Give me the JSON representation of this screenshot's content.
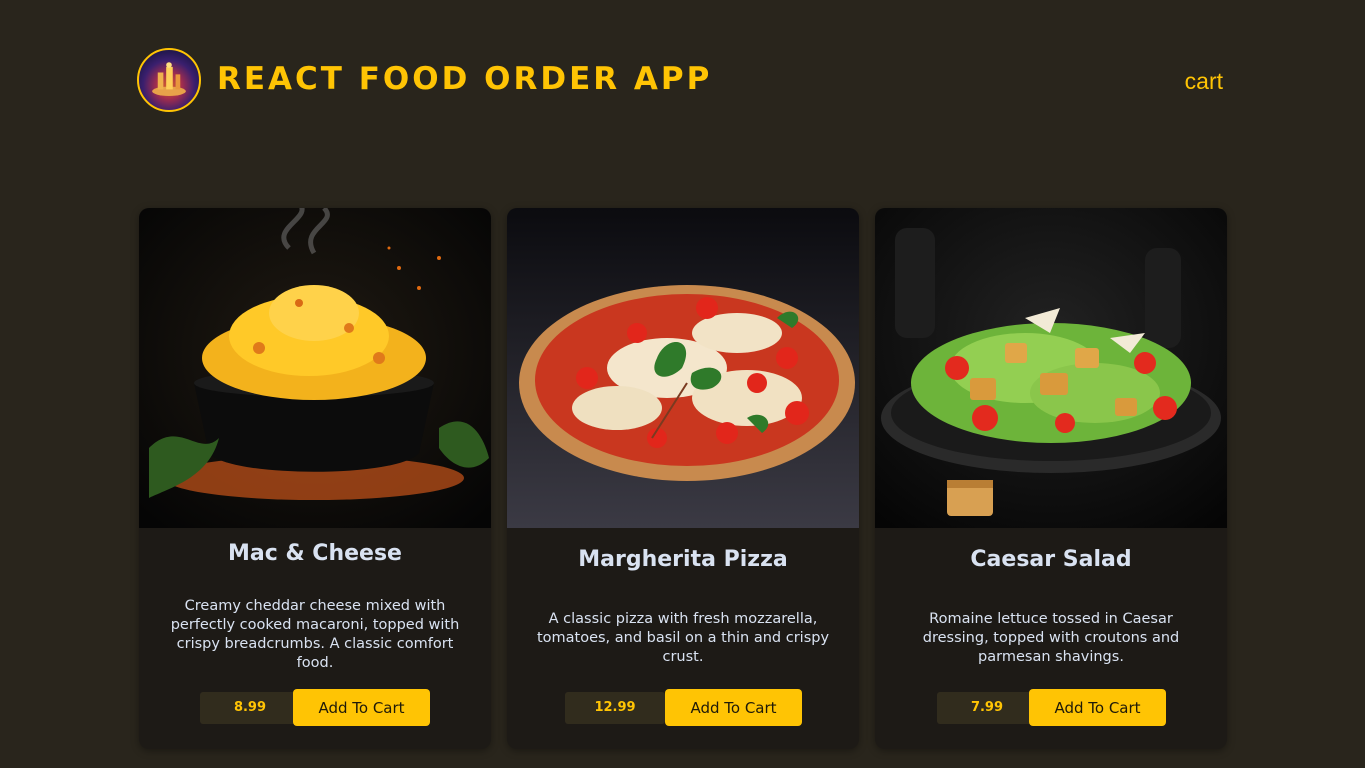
{
  "header": {
    "title": "REACT FOOD ORDER APP",
    "cart_label": "cart",
    "logo_icon": "restaurant-logo-icon"
  },
  "colors": {
    "background": "#29251c",
    "accent": "#ffc404",
    "card": "#1d1a16",
    "price_bg": "#312c1d",
    "text": "#d9e2f1"
  },
  "meals": [
    {
      "name": "Mac & Cheese",
      "description": "Creamy cheddar cheese mixed with perfectly cooked macaroni, topped with crispy breadcrumbs. A classic comfort food.",
      "price": "8.99",
      "button_label": "Add To Cart",
      "image_icon": "mac-and-cheese-image"
    },
    {
      "name": "Margherita Pizza",
      "description": "A classic pizza with fresh mozzarella, tomatoes, and basil on a thin and crispy crust.",
      "price": "12.99",
      "button_label": "Add To Cart",
      "image_icon": "margherita-pizza-image"
    },
    {
      "name": "Caesar Salad",
      "description": "Romaine lettuce tossed in Caesar dressing, topped with croutons and parmesan shavings.",
      "price": "7.99",
      "button_label": "Add To Cart",
      "image_icon": "caesar-salad-image"
    }
  ]
}
